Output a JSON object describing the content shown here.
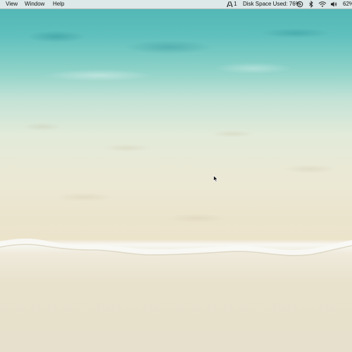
{
  "menubar": {
    "menus": [
      {
        "label": "View"
      },
      {
        "label": "Window"
      },
      {
        "label": "Help"
      }
    ],
    "status": {
      "adobe_icon": "adobe-cc-icon",
      "adobe_count": "1",
      "disk_space": "Disk Space Used: 76%",
      "time_machine_icon": "time-machine-icon",
      "bluetooth_icon": "bluetooth-icon",
      "wifi_icon": "wifi-icon",
      "volume_icon": "speaker-volume-icon",
      "battery_text": "62%"
    }
  },
  "desktop": {
    "wallpaper": "tropical-beach-shoreline",
    "colors": {
      "water": "#4fb5b3",
      "sand": "#e6e0cc",
      "foam": "#f7f7f2"
    }
  },
  "cursor": {
    "icon": "mouse-pointer-icon"
  }
}
